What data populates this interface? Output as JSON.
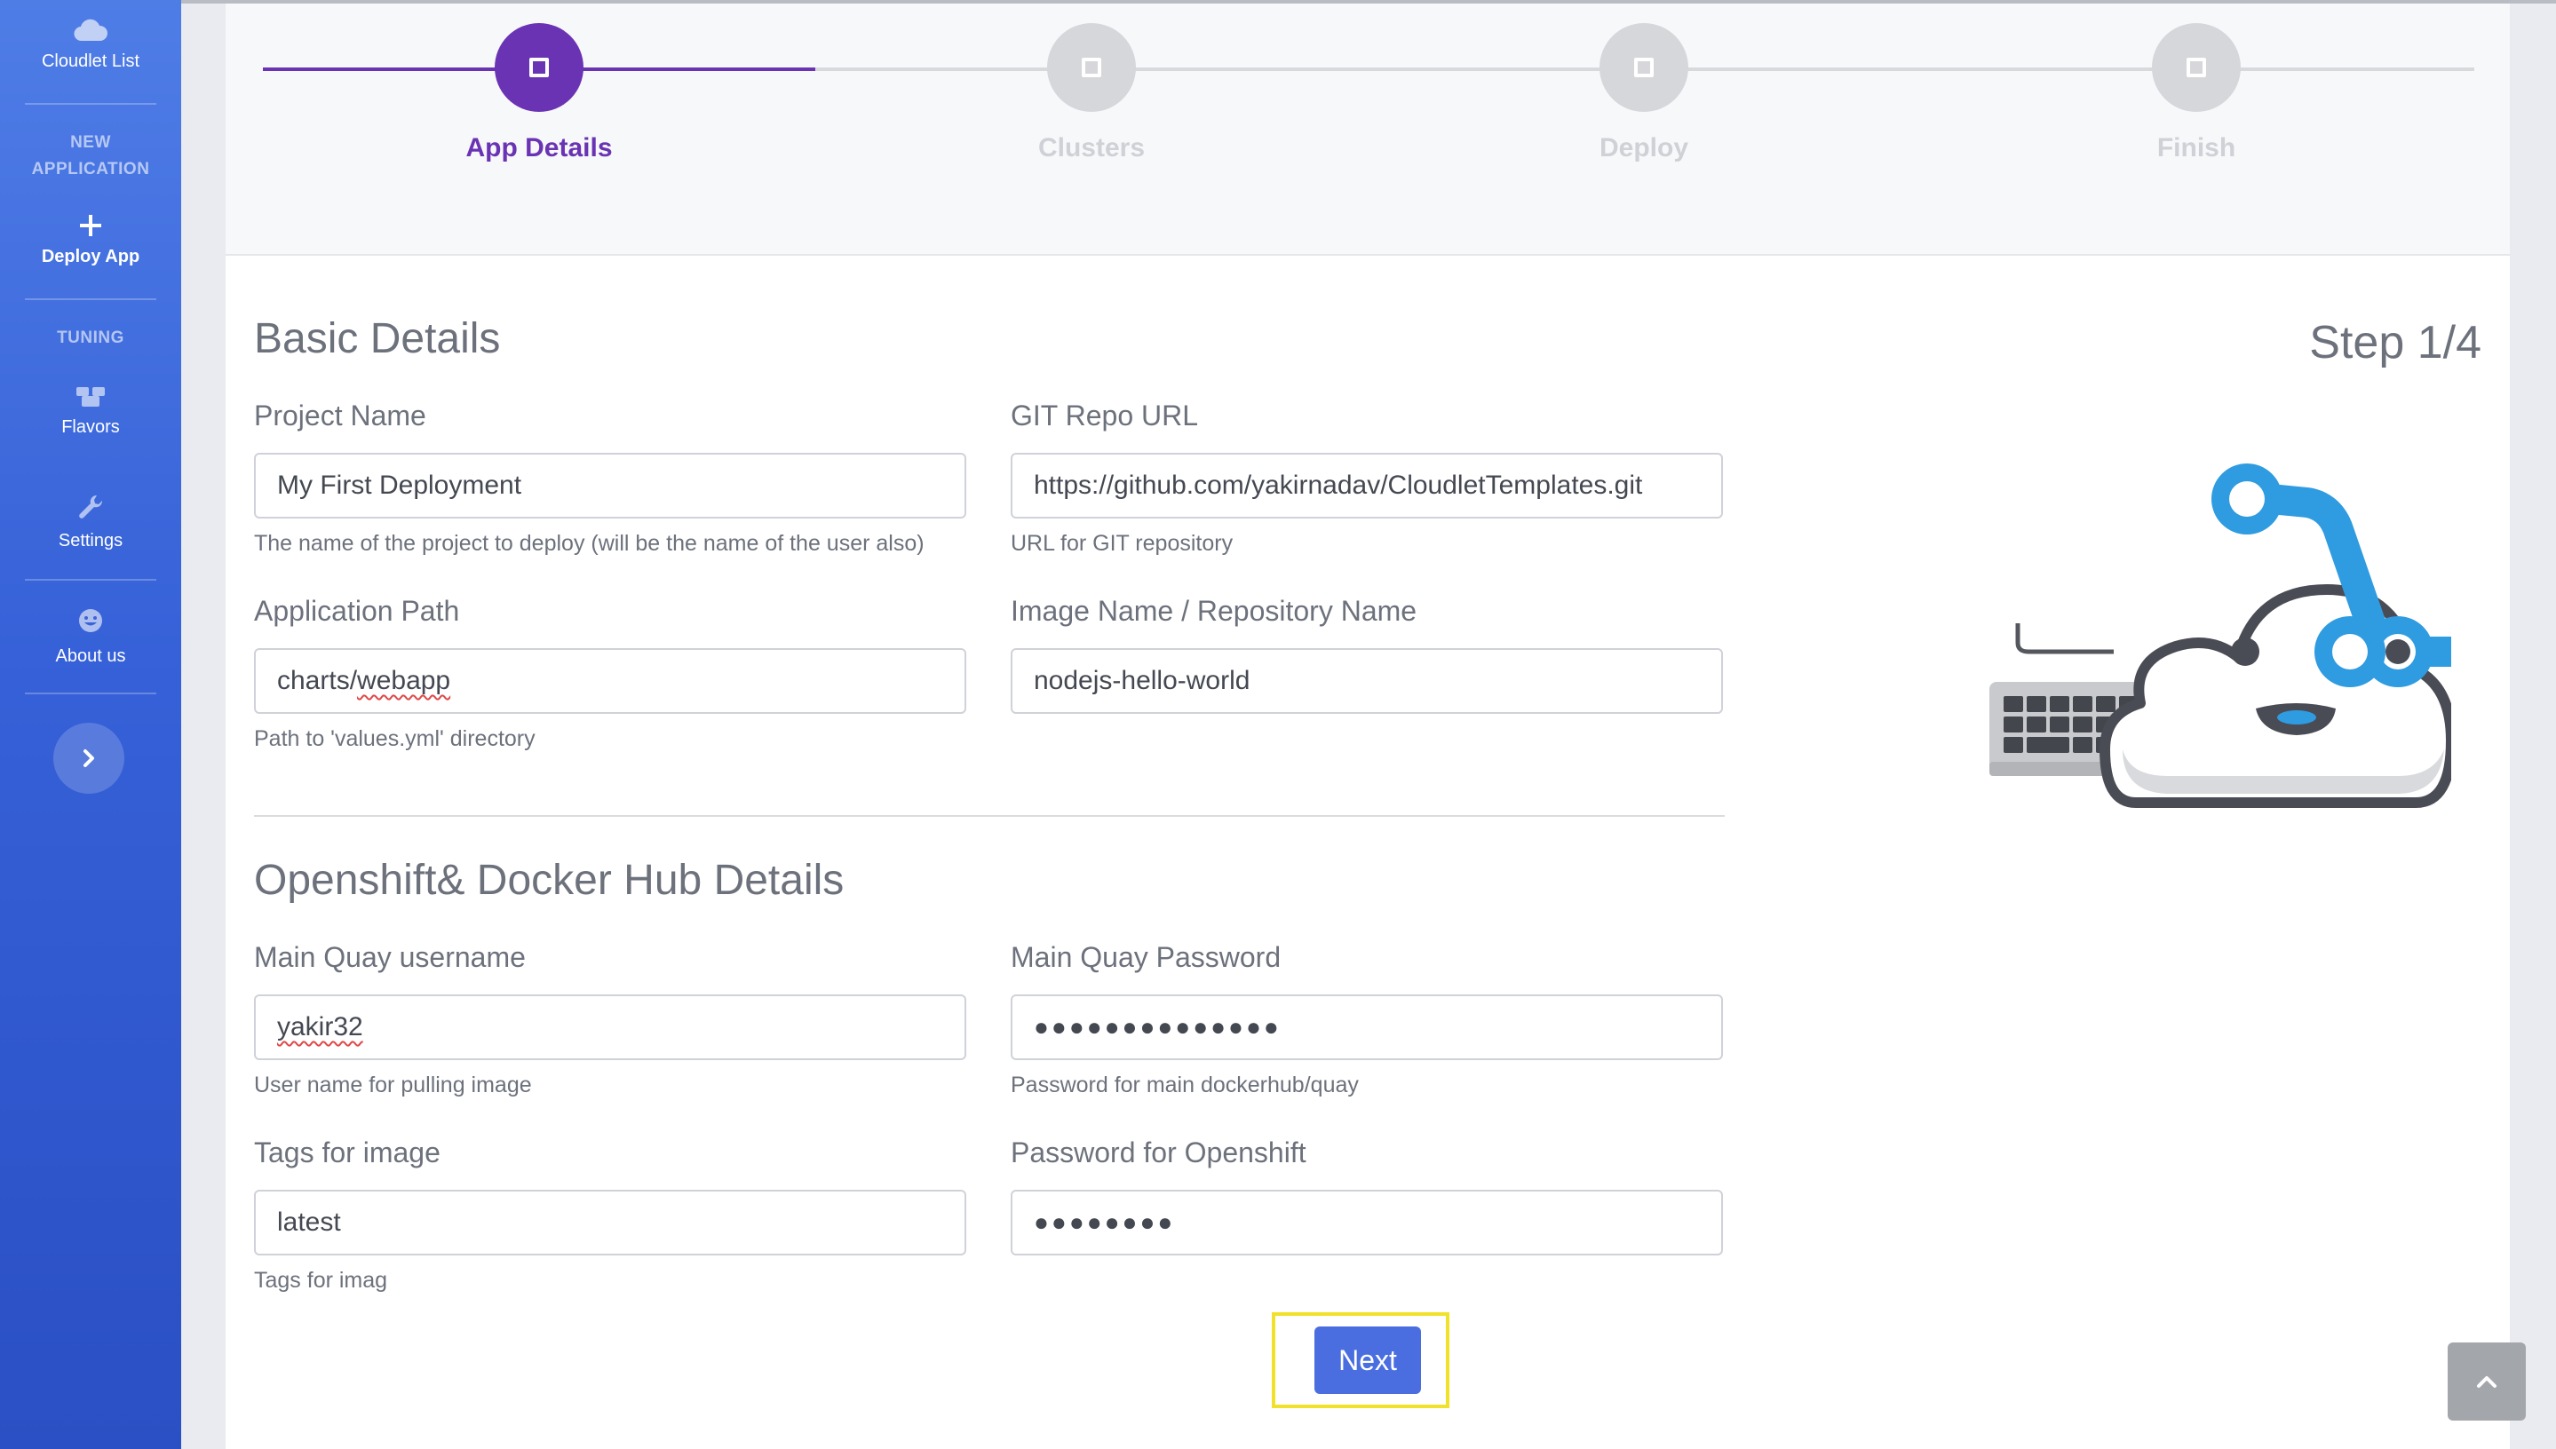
{
  "sidebar": {
    "cloudlet_list": "Cloudlet List",
    "section_new_application_line1": "NEW",
    "section_new_application_line2": "APPLICATION",
    "deploy_app": "Deploy App",
    "section_tuning": "TUNING",
    "flavors": "Flavors",
    "settings": "Settings",
    "about_us": "About us"
  },
  "stepper": {
    "steps": [
      {
        "label": "App Details",
        "state": "active"
      },
      {
        "label": "Clusters",
        "state": "inactive"
      },
      {
        "label": "Deploy",
        "state": "inactive"
      },
      {
        "label": "Finish",
        "state": "inactive"
      }
    ],
    "active_color": "#6a33b3",
    "inactive_color": "#d6d7da"
  },
  "form": {
    "step_counter": "Step 1/4",
    "basic_title": "Basic Details",
    "project_name": {
      "label": "Project Name",
      "value": "My First Deployment",
      "help": "The name of the project to deploy (will be the name of the user also)"
    },
    "git_repo_url": {
      "label": "GIT Repo URL",
      "value": "https://github.com/yakirnadav/CloudletTemplates.git",
      "help": "URL for GIT repository"
    },
    "application_path": {
      "label": "Application Path",
      "value": "charts/webapp",
      "value_prefix": "charts/",
      "value_flagged": "webapp",
      "help": "Path to 'values.yml' directory"
    },
    "image_name": {
      "label": "Image Name / Repository Name",
      "value": "nodejs-hello-world"
    },
    "openshift_title": "Openshift& Docker Hub Details",
    "quay_username": {
      "label": "Main Quay username",
      "value": "yakir32",
      "help": "User name for pulling image"
    },
    "quay_password": {
      "label": "Main Quay Password",
      "value": "●●●●●●●●●●●●●●",
      "help": "Password for main dockerhub/quay"
    },
    "tags": {
      "label": "Tags for image",
      "value": "latest",
      "help": "Tags for imag"
    },
    "openshift_password": {
      "label": "Password for Openshift",
      "value": "●●●●●●●●"
    },
    "next_label": "Next"
  },
  "icons": {
    "sidebar_cloud": "cloud-icon",
    "sidebar_plus": "plus-icon",
    "sidebar_flavors": "boxes-icon",
    "sidebar_settings": "wrench-icon",
    "sidebar_about": "smiley-icon",
    "sidebar_toggle": "chevron-right-icon",
    "step": "square-icon",
    "scroll_top": "chevron-up-icon",
    "illustration": "cloud-git-keyboard-illustration"
  },
  "colors": {
    "sidebar_top": "#4f7de6",
    "sidebar_bottom": "#2b4fc4",
    "primary_button": "#4a6ee0",
    "highlight_outline": "#f1e12a",
    "git_blue": "#2f9be0"
  }
}
